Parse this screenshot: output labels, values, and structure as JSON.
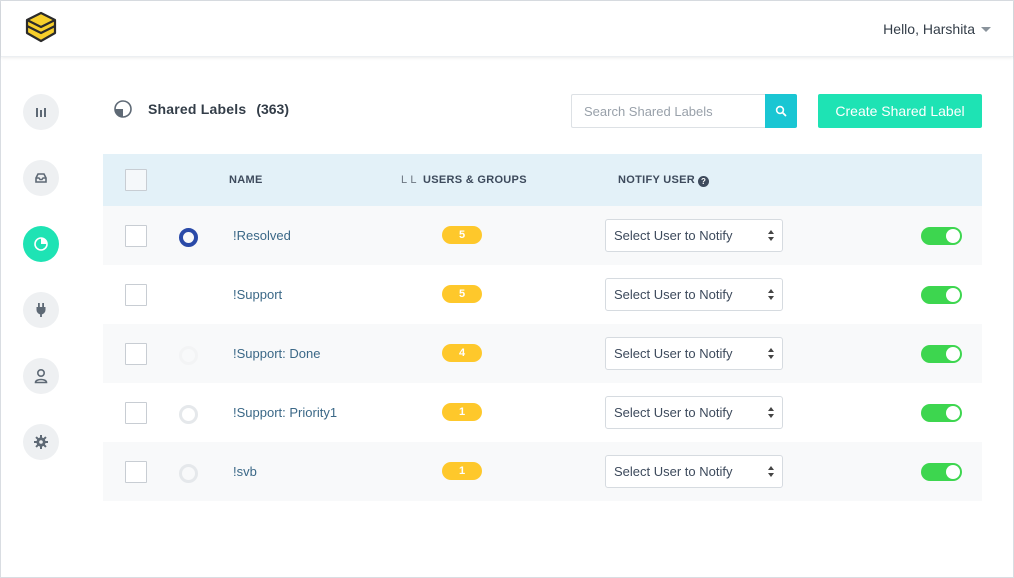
{
  "header": {
    "greeting": "Hello, Harshita",
    "brand_color": "#f7cf2b"
  },
  "sidebar": {
    "items": [
      {
        "name": "reports",
        "icon": "bar-chart-icon",
        "active": false
      },
      {
        "name": "inbox",
        "icon": "inbox-tray-icon",
        "active": false
      },
      {
        "name": "shared-labels",
        "icon": "pie-chart-icon",
        "active": true
      },
      {
        "name": "integrations",
        "icon": "plug-icon",
        "active": false
      },
      {
        "name": "users",
        "icon": "user-icon",
        "active": false
      },
      {
        "name": "settings",
        "icon": "gear-icon",
        "active": false
      }
    ],
    "active_color": "#1ee3b4"
  },
  "page": {
    "title": "Shared Labels",
    "count": "(363)",
    "search_placeholder": "Search Shared Labels",
    "create_button": "Create Shared Label"
  },
  "table": {
    "columns": {
      "name": "NAME",
      "users_groups_prefix": "l l",
      "users_groups": "USERS & GROUPS",
      "notify_user": "NOTIFY USER"
    },
    "rows": [
      {
        "name": "!Resolved",
        "count": "5",
        "notify": "Select User to Notify",
        "color_ring": "blue",
        "enabled": true
      },
      {
        "name": "!Support",
        "count": "5",
        "notify": "Select User to Notify",
        "color_ring": "none",
        "enabled": true
      },
      {
        "name": "!Support: Done",
        "count": "4",
        "notify": "Select User to Notify",
        "color_ring": "faint",
        "enabled": true
      },
      {
        "name": "!Support: Priority1",
        "count": "1",
        "notify": "Select User to Notify",
        "color_ring": "grey",
        "enabled": true
      },
      {
        "name": "!svb",
        "count": "1",
        "notify": "Select User to Notify",
        "color_ring": "grey",
        "enabled": true
      }
    ]
  },
  "colors": {
    "accent": "#1ee3b4",
    "search_button": "#1ac6d3",
    "badge": "#fec82b",
    "toggle_on": "#3dd64f",
    "header_row": "#e3f1f8",
    "label_link": "#3b6887"
  }
}
